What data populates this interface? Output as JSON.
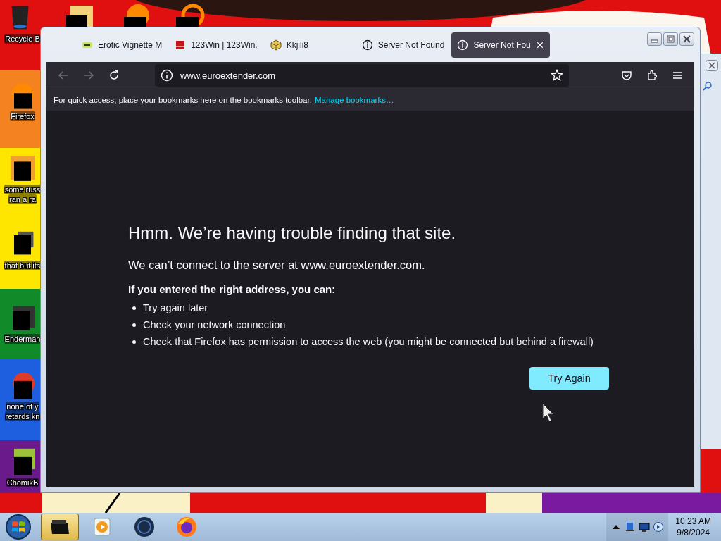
{
  "desktop": {
    "icons": [
      {
        "kind": "bin",
        "lines": [
          "Recycle B"
        ]
      },
      {
        "kind": "fox",
        "lines": [
          "Firefox"
        ]
      },
      {
        "kind": "doc",
        "lines": [
          "some russ",
          "ran a ra"
        ]
      },
      {
        "kind": "stack",
        "lines": [
          "that but its"
        ]
      },
      {
        "kind": "term",
        "lines": [
          "Enderman"
        ]
      },
      {
        "kind": "ball",
        "lines": [
          "none of y",
          "retards kn"
        ]
      },
      {
        "kind": "hamster",
        "lines": [
          "ChomikB"
        ]
      }
    ]
  },
  "browser": {
    "tabs": [
      {
        "kind": "hd",
        "title": "Erotic Vignette M",
        "selected": false
      },
      {
        "kind": "win",
        "title": "123Win | 123Win.",
        "selected": false
      },
      {
        "kind": "cube",
        "title": "Kkjili8",
        "selected": false
      },
      {
        "kind": "info",
        "title": "Server Not Found",
        "selected": false
      },
      {
        "kind": "info",
        "title": "Server Not Fou",
        "selected": true
      }
    ],
    "nav": [
      {
        "kind": "back",
        "disabled": true
      },
      {
        "kind": "forward",
        "disabled": true
      },
      {
        "kind": "reload",
        "disabled": false
      }
    ],
    "address": "www.euroextender.com",
    "bookmarks_bar": {
      "text": "For quick access, place your bookmarks here on the bookmarks toolbar.",
      "link": "Manage bookmarks…"
    },
    "page": {
      "heading": "Hmm. We’re having trouble finding that site.",
      "message": "We can’t connect to the server at www.euroextender.com.",
      "subheading": "If you entered the right address, you can:",
      "suggestions": [
        "Try again later",
        "Check your network connection",
        "Check that Firefox has permission to access the web (you might be connected but behind a firewall)"
      ],
      "button": "Try Again"
    }
  },
  "taskbar": {
    "buttons": [
      {
        "kind": "explorer",
        "selected": true
      },
      {
        "kind": "media",
        "selected": false
      },
      {
        "kind": "globe",
        "selected": false
      },
      {
        "kind": "firefox",
        "selected": false
      }
    ],
    "clock": {
      "time": "10:23 AM",
      "date": "9/8/2024"
    }
  }
}
